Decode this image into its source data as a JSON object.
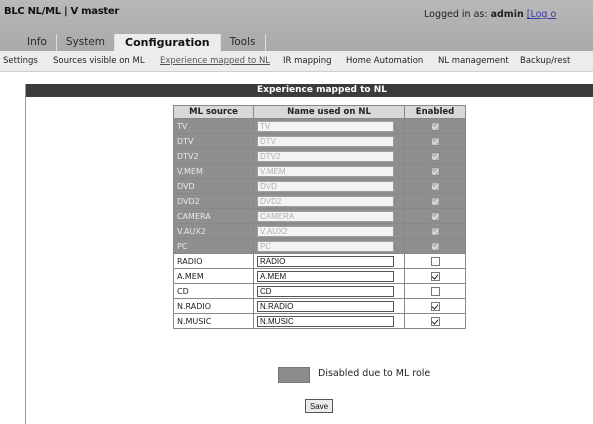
{
  "header": {
    "title": "BLC NL/ML | V master",
    "logged_in_prefix": "Logged in as:",
    "user": "admin",
    "logout": "[Log o"
  },
  "tabs": [
    {
      "label": "Info",
      "active": false
    },
    {
      "label": "System",
      "active": false
    },
    {
      "label": "Configuration",
      "active": true
    },
    {
      "label": "Tools",
      "active": false
    }
  ],
  "subnav": [
    {
      "label": "Settings",
      "active": false
    },
    {
      "label": "Sources visible on ML",
      "active": false
    },
    {
      "label": "Experience mapped to NL",
      "active": true
    },
    {
      "label": "IR mapping",
      "active": false
    },
    {
      "label": "Home Automation",
      "active": false
    },
    {
      "label": "NL management",
      "active": false
    },
    {
      "label": "Backup/rest",
      "active": false
    }
  ],
  "panel": {
    "title": "Experience mapped to NL"
  },
  "table": {
    "columns": [
      "ML source",
      "Name used on NL",
      "Enabled"
    ],
    "rows": [
      {
        "source": "TV",
        "name": "TV",
        "enabled": true,
        "disabled": true
      },
      {
        "source": "DTV",
        "name": "DTV",
        "enabled": true,
        "disabled": true
      },
      {
        "source": "DTV2",
        "name": "DTV2",
        "enabled": true,
        "disabled": true
      },
      {
        "source": "V.MEM",
        "name": "V.MEM",
        "enabled": true,
        "disabled": true
      },
      {
        "source": "DVD",
        "name": "DVD",
        "enabled": true,
        "disabled": true
      },
      {
        "source": "DVD2",
        "name": "DVD2",
        "enabled": true,
        "disabled": true
      },
      {
        "source": "CAMERA",
        "name": "CAMERA",
        "enabled": true,
        "disabled": true
      },
      {
        "source": "V.AUX2",
        "name": "V.AUX2",
        "enabled": true,
        "disabled": true
      },
      {
        "source": "PC",
        "name": "PC",
        "enabled": true,
        "disabled": true
      },
      {
        "source": "RADIO",
        "name": "RADIO",
        "enabled": false,
        "disabled": false
      },
      {
        "source": "A.MEM",
        "name": "A.MEM",
        "enabled": true,
        "disabled": false
      },
      {
        "source": "CD",
        "name": "CD",
        "enabled": false,
        "disabled": false
      },
      {
        "source": "N.RADIO",
        "name": "N.RADIO",
        "enabled": true,
        "disabled": false
      },
      {
        "source": "N.MUSIC",
        "name": "N.MUSIC",
        "enabled": true,
        "disabled": false
      }
    ]
  },
  "legend": {
    "text": "Disabled due to ML role",
    "swatch_color": "#8c8c8c"
  },
  "save_label": "Save",
  "colors": {
    "topbar": "#b0b0b0",
    "panel_header": "#3b3b3b",
    "disabled_row": "#8f8f8f"
  }
}
